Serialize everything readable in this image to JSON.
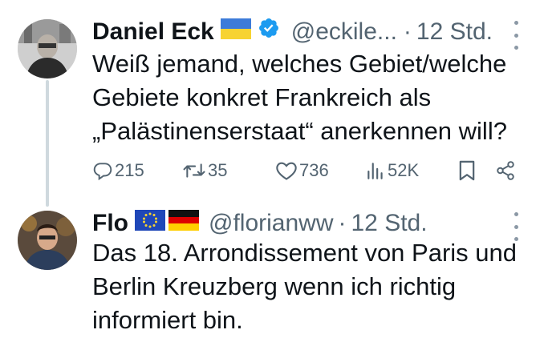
{
  "tweets": [
    {
      "author_name": "Daniel Eck",
      "handle": "@eckile...",
      "separator": "·",
      "time": "12 Std.",
      "text": "Weiß jemand, welches Gebiet/welche\nGebiete konkret Frankreich als\n„Palästinenserstaat“ anerkennen will?",
      "flags": [
        "ukraine-flag"
      ],
      "verified": true,
      "stats": {
        "replies": "215",
        "reposts": "35",
        "likes": "736",
        "views": "52K"
      }
    },
    {
      "author_name": "Flo",
      "handle": "@florianww",
      "separator": "·",
      "time": "12 Std.",
      "text": "Das 18. Arrondissement von Paris und\nBerlin Kreuzberg wenn ich richtig\ninformiert bin.",
      "flags": [
        "eu-flag",
        "germany-flag"
      ]
    }
  ],
  "colors": {
    "text": "#0f1419",
    "secondary": "#536471",
    "verified": "#1d9bf0",
    "thread_line": "#cfd9de"
  }
}
